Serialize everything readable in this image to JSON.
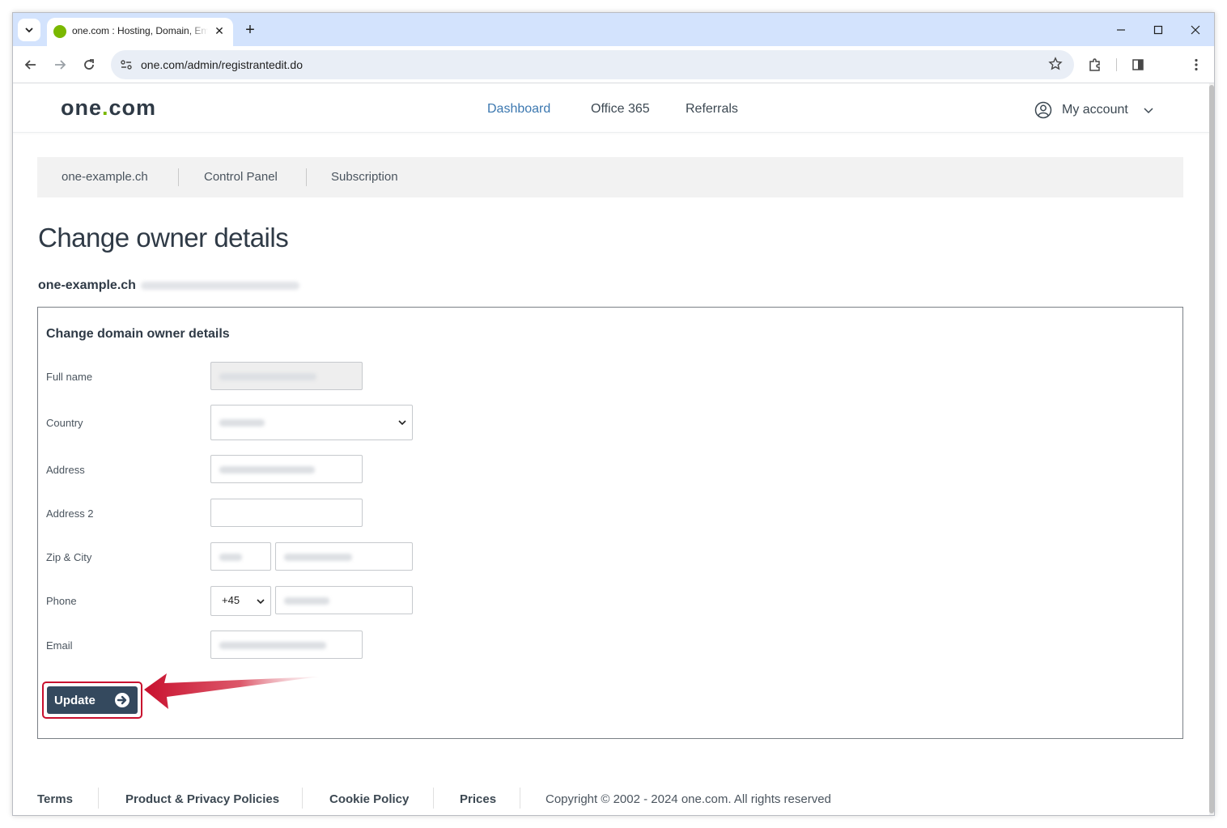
{
  "browser": {
    "tab_title": "one.com : Hosting, Domain, Email",
    "tab_favicon_color": "#7ab800",
    "url": "one.com/admin/registrantedit.do"
  },
  "header": {
    "logo_one": "one",
    "logo_dot": ".",
    "logo_com": "com",
    "nav": [
      "Dashboard",
      "Office 365",
      "Referrals"
    ],
    "active_nav": "Dashboard",
    "account_label": "My account"
  },
  "breadcrumb": [
    "one-example.ch",
    "Control Panel",
    "Subscription"
  ],
  "page_title": "Change owner details",
  "domain": "one-example.ch",
  "form": {
    "title": "Change domain owner details",
    "labels": {
      "full_name": "Full name",
      "country": "Country",
      "address": "Address",
      "address2": "Address 2",
      "zip_city": "Zip & City",
      "phone": "Phone",
      "email": "Email"
    },
    "phone_code": "+45",
    "update_label": "Update"
  },
  "footer": {
    "links": [
      "Terms",
      "Product & Privacy Policies",
      "Cookie Policy",
      "Prices"
    ],
    "copyright": "Copyright © 2002 - 2024 one.com. All rights reserved"
  },
  "colors": {
    "brand_dark": "#34495e",
    "brand_green": "#7ab800",
    "nav_active": "#3c78b0",
    "annotation_red": "#c8102e"
  }
}
